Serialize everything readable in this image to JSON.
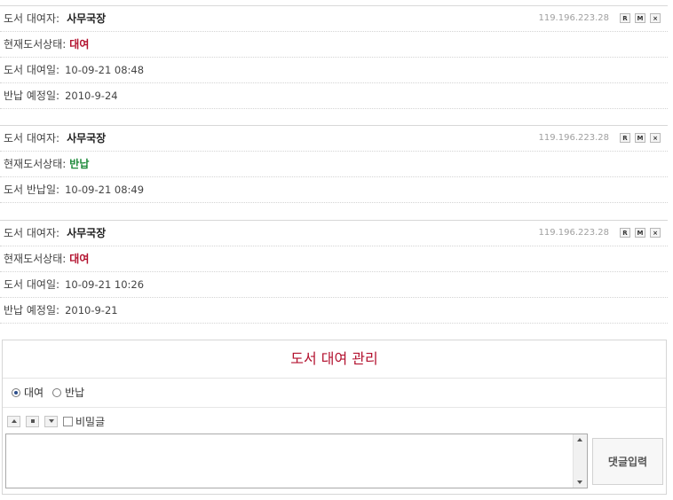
{
  "entries": [
    {
      "ip": "119.196.223.28",
      "buttons": {
        "reply": "R",
        "modify": "M",
        "delete": "×"
      },
      "lines": [
        {
          "label": "도서 대여자:",
          "value": "사무국장",
          "kind": "user"
        },
        {
          "label": "현재도서상태:",
          "value": "대여",
          "kind": "status",
          "color": "#b3122f"
        },
        {
          "label": "도서 대여일:",
          "value": "10-09-21 08:48",
          "kind": "plain"
        },
        {
          "label": "반납 예정일:",
          "value": "2010-9-24",
          "kind": "plain"
        }
      ]
    },
    {
      "ip": "119.196.223.28",
      "buttons": {
        "reply": "R",
        "modify": "M",
        "delete": "×"
      },
      "lines": [
        {
          "label": "도서 대여자:",
          "value": "사무국장",
          "kind": "user"
        },
        {
          "label": "현재도서상태:",
          "value": "반납",
          "kind": "status",
          "color": "#1e8a3a"
        },
        {
          "label": "도서 반납일:",
          "value": "10-09-21 08:49",
          "kind": "plain"
        }
      ]
    },
    {
      "ip": "119.196.223.28",
      "buttons": {
        "reply": "R",
        "modify": "M",
        "delete": "×"
      },
      "lines": [
        {
          "label": "도서 대여자:",
          "value": "사무국장",
          "kind": "user"
        },
        {
          "label": "현재도서상태:",
          "value": "대여",
          "kind": "status",
          "color": "#b3122f"
        },
        {
          "label": "도서 대여일:",
          "value": "10-09-21 10:26",
          "kind": "plain"
        },
        {
          "label": "반납 예정일:",
          "value": "2010-9-21",
          "kind": "plain"
        }
      ]
    }
  ],
  "manage": {
    "title": "도서 대여 관리",
    "radio_rent": "대여",
    "radio_return": "반납",
    "selected": "대여",
    "secret_label": "비밀글",
    "comment_text": "",
    "submit_label": "댓글입력",
    "accent_color": "#b3122f"
  },
  "icons": {
    "move_up": "triangle-up-icon",
    "reset": "square-icon",
    "move_down": "triangle-down-icon"
  }
}
